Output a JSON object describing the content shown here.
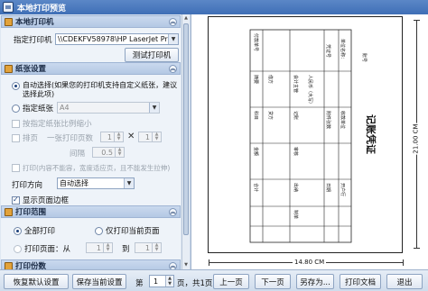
{
  "window": {
    "title": "本地打印预览"
  },
  "local_printer": {
    "header": "本地打印机",
    "printer_label": "指定打印机",
    "printer_value": "\\\\CDEKFV58978\\HP LaserJet Pro MFP M12",
    "test_button": "测试打印机"
  },
  "paper": {
    "header": "纸张设置",
    "auto_select": "自动选择(如果您的打印机支持自定义纸张，建议选择此项)",
    "specify_paper": "指定纸张",
    "paper_value": "A4",
    "scale_to_fit": "按指定纸张比例缩小",
    "tile_label": "排页",
    "per_page_label": "一张打印页数",
    "tile_cols": "1",
    "tile_rows": "1",
    "spacing_label": "间隔",
    "spacing_value": "0.5",
    "fit_wide": "打印(内容不能容，宽度适应页，且不能发生拉伸)",
    "direction_label": "打印方向",
    "direction_value": "自动选择",
    "show_border": "显示页面边框"
  },
  "range": {
    "header": "打印范围",
    "all_pages": "全部打印",
    "current_page": "仅打印当前页面",
    "page_from_label": "打印页面：从",
    "from_value": "1",
    "to_label": "到",
    "to_value": "1"
  },
  "copies": {
    "header": "打印份数"
  },
  "preview": {
    "width_label": "14.80 CM",
    "height_label": "21.00 CM",
    "doc_title": "记账凭证",
    "doc_texts": [
      "付款单号",
      "摘要",
      "科目",
      "金额",
      "合计",
      "借方",
      "贷方",
      "会计主管",
      "记账",
      "审核",
      "出纳",
      "制单",
      "人民币（大写）",
      "凭证号",
      "附件张数",
      "日期",
      "单位名称：",
      "收款单位",
      "开户行",
      "账号"
    ]
  },
  "toolbar": {
    "reset_button": "恢复默认设置",
    "save_button": "保存当前设置",
    "page_prefix": "第",
    "page_value": "1",
    "page_suffix": "页，共1页",
    "prev_button": "上一页",
    "next_button": "下一页",
    "save_as_button": "另存为...",
    "print_button": "打印文档",
    "exit_button": "退出"
  }
}
